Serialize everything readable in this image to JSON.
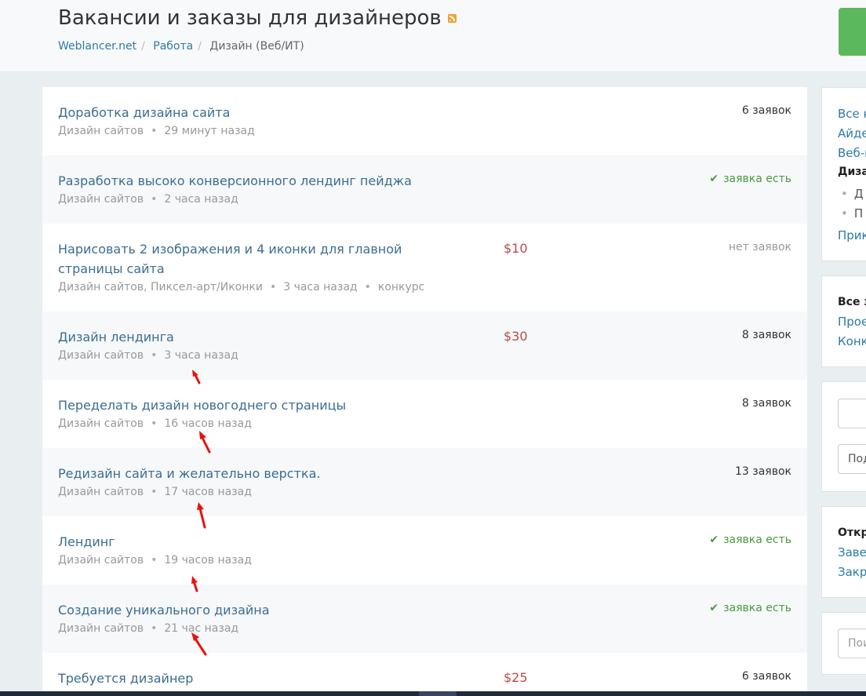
{
  "header": {
    "title": "Вакансии и заказы для дизайнеров",
    "rss_icon": "rss-icon",
    "breadcrumb": [
      "Weblancer.net",
      "Работа",
      "Дизайн (Веб/ИТ)"
    ]
  },
  "jobs": [
    {
      "title": "Доработка дизайна сайта",
      "meta": [
        "Дизайн сайтов",
        "29 минут назад"
      ],
      "price": "",
      "bids": "6 заявок",
      "bids_type": "count"
    },
    {
      "title": "Разработка высоко конверсионного лендинг пейджа",
      "meta": [
        "Дизайн сайтов",
        "2 часа назад"
      ],
      "price": "",
      "bids": "заявка есть",
      "bids_type": "has"
    },
    {
      "title": "Нарисовать 2 изображения и 4 иконки для главной страницы сайта",
      "meta": [
        "Дизайн сайтов, Пиксел-арт/Иконки",
        "3 часа назад",
        "конкурс"
      ],
      "price": "$10",
      "bids": "нет заявок",
      "bids_type": "none"
    },
    {
      "title": "Дизайн лендинга",
      "meta": [
        "Дизайн сайтов",
        "3 часа назад"
      ],
      "price": "$30",
      "bids": "8 заявок",
      "bids_type": "count"
    },
    {
      "title": "Переделать дизайн новогоднего страницы",
      "meta": [
        "Дизайн сайтов",
        "16 часов назад"
      ],
      "price": "",
      "bids": "8 заявок",
      "bids_type": "count"
    },
    {
      "title": "Редизайн сайта и желательно верстка.",
      "meta": [
        "Дизайн сайтов",
        "17 часов назад"
      ],
      "price": "",
      "bids": "13 заявок",
      "bids_type": "count"
    },
    {
      "title": "Лендинг",
      "meta": [
        "Дизайн сайтов",
        "19 часов назад"
      ],
      "price": "",
      "bids": "заявка есть",
      "bids_type": "has"
    },
    {
      "title": "Создание уникального дизайна",
      "meta": [
        "Дизайн сайтов",
        "21 час назад"
      ],
      "price": "",
      "bids": "заявка есть",
      "bids_type": "has"
    },
    {
      "title": "Требуется дизайнер",
      "meta": [],
      "price": "$25",
      "bids": "6 заявок",
      "bids_type": "count"
    }
  ],
  "sidebar": {
    "categories": {
      "links": [
        "Все к",
        "Айде",
        "Веб-п"
      ],
      "current": "Дизай",
      "subitems": [
        "Д",
        "П"
      ],
      "last": "Прик"
    },
    "types": {
      "heading": "Все за",
      "links": [
        "Прое",
        "Конку"
      ]
    },
    "filters": {
      "input_value": "",
      "select_value": "Под"
    },
    "status": {
      "heading": "Откр",
      "links": [
        "Завер",
        "Закры"
      ]
    },
    "search": {
      "placeholder": "Пои"
    }
  },
  "colors": {
    "link": "#3c6d91",
    "price": "#b94a48",
    "has_bid": "#4a9a3f",
    "accent_button": "#5cb85c"
  }
}
